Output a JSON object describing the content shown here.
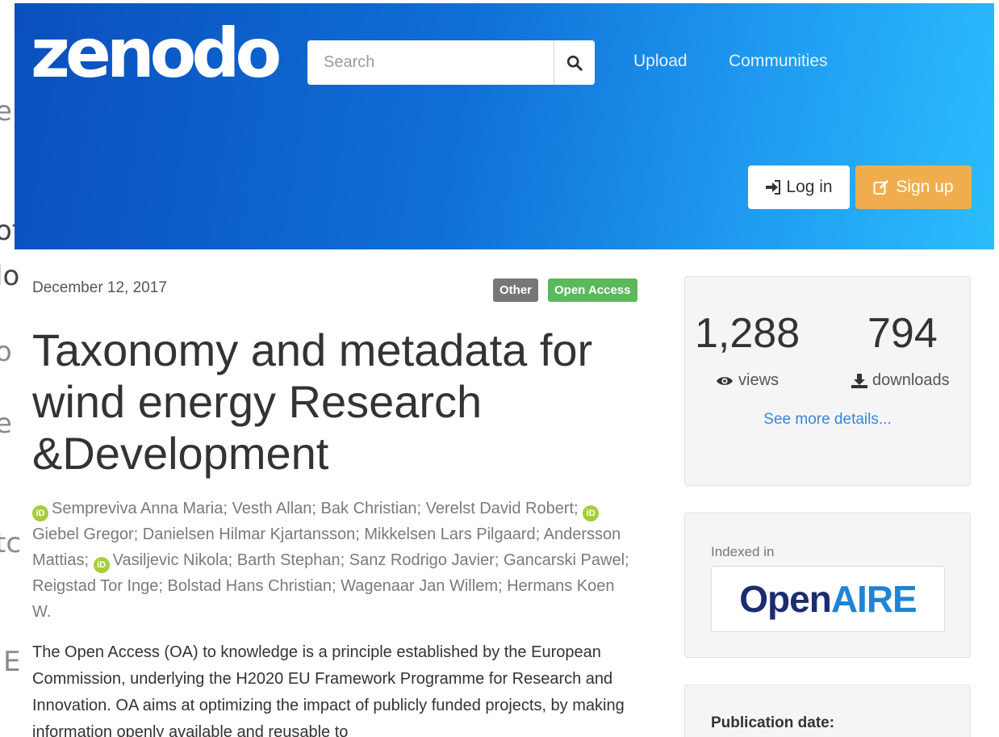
{
  "background_fragments": [
    "en",
    "of",
    "lo",
    "o",
    "e",
    "tc",
    "E"
  ],
  "header": {
    "logo": "zenodo",
    "search": {
      "placeholder": "Search"
    },
    "nav": {
      "upload": "Upload",
      "communities": "Communities"
    },
    "login_label": "Log in",
    "signup_label": "Sign up"
  },
  "record": {
    "date": "December 12, 2017",
    "badges": {
      "type": "Other",
      "access": "Open Access"
    },
    "title": "Taxonomy and metadata for wind energy Research &Development",
    "authors": [
      {
        "name": "Sempreviva Anna Maria",
        "orcid": true
      },
      {
        "name": "Vesth Allan",
        "orcid": false
      },
      {
        "name": "Bak Christian",
        "orcid": false
      },
      {
        "name": "Verelst David Robert",
        "orcid": false
      },
      {
        "name": "Giebel Gregor",
        "orcid": true
      },
      {
        "name": "Danielsen Hilmar Kjartansson",
        "orcid": false
      },
      {
        "name": "Mikkelsen Lars Pilgaard",
        "orcid": false
      },
      {
        "name": "Andersson Mattias",
        "orcid": false
      },
      {
        "name": "Vasiljevic Nikola",
        "orcid": true
      },
      {
        "name": "Barth Stephan",
        "orcid": false
      },
      {
        "name": "Sanz Rodrigo Javier",
        "orcid": false
      },
      {
        "name": "Gancarski Pawel",
        "orcid": false
      },
      {
        "name": "Reigstad Tor Inge",
        "orcid": false
      },
      {
        "name": "Bolstad Hans Christian",
        "orcid": false
      },
      {
        "name": "Wagenaar Jan Willem",
        "orcid": false
      },
      {
        "name": "Hermans Koen W.",
        "orcid": false
      }
    ],
    "orcid_badge": "iD",
    "abstract": "The Open Access (OA) to knowledge is a principle established by the European Commission, underlying the H2020 EU Framework Programme for Research and Innovation. OA aims at optimizing the impact of publicly funded projects, by making information openly available and reusable to"
  },
  "sidebar": {
    "views_count": "1,288",
    "views_label": "views",
    "downloads_count": "794",
    "downloads_label": "downloads",
    "more_details": "See more details...",
    "indexed_in": "Indexed in",
    "openaire_open": "Open",
    "openaire_aire": "AIRE",
    "publication_date_label": "Publication date:"
  },
  "colors": {
    "header_gradient_start": "#0a4fbd",
    "header_gradient_end": "#2bbdfd",
    "signup": "#f0ad4e",
    "badge_other": "#777777",
    "badge_open_access": "#5cb85c",
    "link": "#3a86d4",
    "orcid": "#a6ce39"
  }
}
